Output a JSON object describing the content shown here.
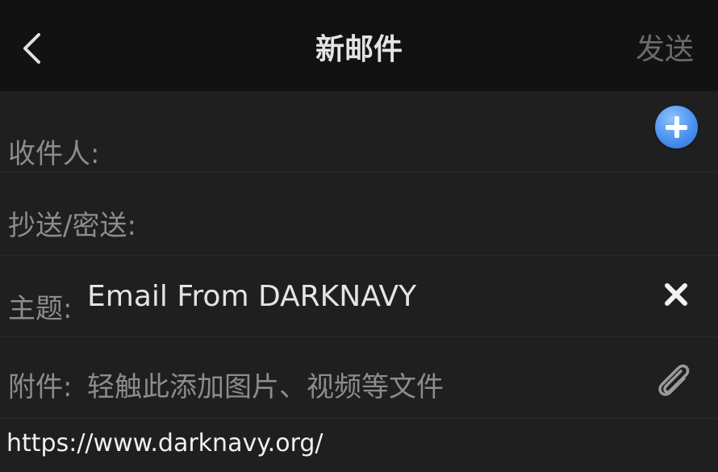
{
  "header": {
    "title": "新邮件",
    "send_label": "发送"
  },
  "fields": {
    "to_label": "收件人:",
    "cc_bcc_label": "抄送/密送:",
    "subject_label": "主题:",
    "subject_value": "Email From DARKNAVY",
    "attachment_label": "附件:",
    "attachment_placeholder": "轻触此添加图片、视频等文件"
  },
  "footer": {
    "url": "https://www.darknavy.org/"
  },
  "icons": {
    "back": "chevron-left-icon",
    "add_recipient": "plus-circle-icon",
    "clear_subject": "close-icon",
    "attach": "paperclip-icon"
  },
  "colors": {
    "background": "#1f1f1f",
    "header_background": "#121212",
    "label_text": "#8c8c8c",
    "value_text": "#e4e4e4",
    "send_disabled": "#6b6b6b",
    "add_button_blue": "#4a92f0"
  }
}
